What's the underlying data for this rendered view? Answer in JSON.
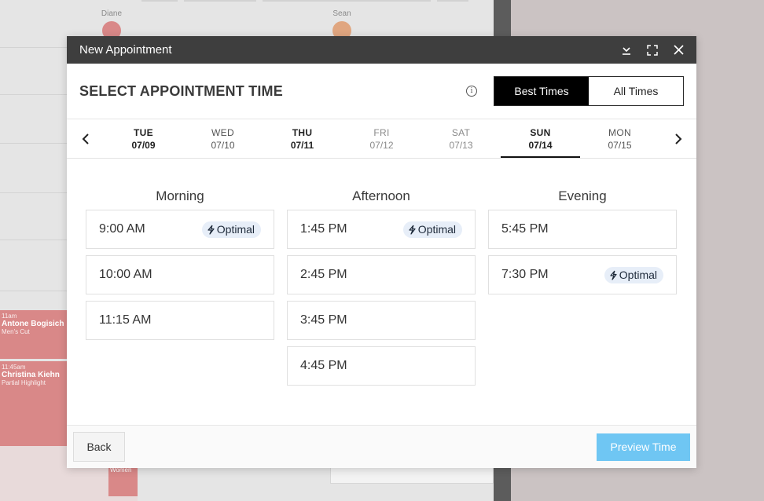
{
  "background": {
    "staff": [
      {
        "name": "Diane"
      },
      {
        "name": "Sean"
      }
    ],
    "appointments": [
      {
        "time": "11am",
        "client": "Antone Bogisich",
        "service": "Men's Cut"
      },
      {
        "time": "11:45am",
        "client": "Christina Kiehn",
        "service": "Partial Highlight"
      }
    ],
    "lower_label": "Women"
  },
  "modal": {
    "title": "New Appointment",
    "section_title": "SELECT APPOINTMENT TIME",
    "info_glyph": "i",
    "toggle": {
      "best": "Best Times",
      "all": "All Times",
      "active": "best"
    },
    "days": [
      {
        "dow": "TUE",
        "date": "07/09",
        "state": "bold"
      },
      {
        "dow": "WED",
        "date": "07/10",
        "state": "normal"
      },
      {
        "dow": "THU",
        "date": "07/11",
        "state": "bold"
      },
      {
        "dow": "FRI",
        "date": "07/12",
        "state": "muted"
      },
      {
        "dow": "SAT",
        "date": "07/13",
        "state": "muted"
      },
      {
        "dow": "SUN",
        "date": "07/14",
        "state": "selected"
      },
      {
        "dow": "MON",
        "date": "07/15",
        "state": "normal"
      }
    ],
    "columns": [
      {
        "title": "Morning",
        "slots": [
          {
            "time": "9:00 AM",
            "badge": "Optimal"
          },
          {
            "time": "10:00 AM",
            "badge": ""
          },
          {
            "time": "11:15 AM",
            "badge": ""
          }
        ]
      },
      {
        "title": "Afternoon",
        "slots": [
          {
            "time": "1:45 PM",
            "badge": "Optimal"
          },
          {
            "time": "2:45 PM",
            "badge": ""
          },
          {
            "time": "3:45 PM",
            "badge": ""
          },
          {
            "time": "4:45 PM",
            "badge": ""
          }
        ]
      },
      {
        "title": "Evening",
        "slots": [
          {
            "time": "5:45 PM",
            "badge": ""
          },
          {
            "time": "7:30 PM",
            "badge": "Optimal"
          }
        ]
      }
    ],
    "footer": {
      "back": "Back",
      "preview": "Preview Time"
    },
    "colors": {
      "titlebar": "#3e3e3e",
      "preview_button": "#6fc6f3",
      "badge_bg": "#e7eef8",
      "appointment_block": "#d98888"
    }
  }
}
